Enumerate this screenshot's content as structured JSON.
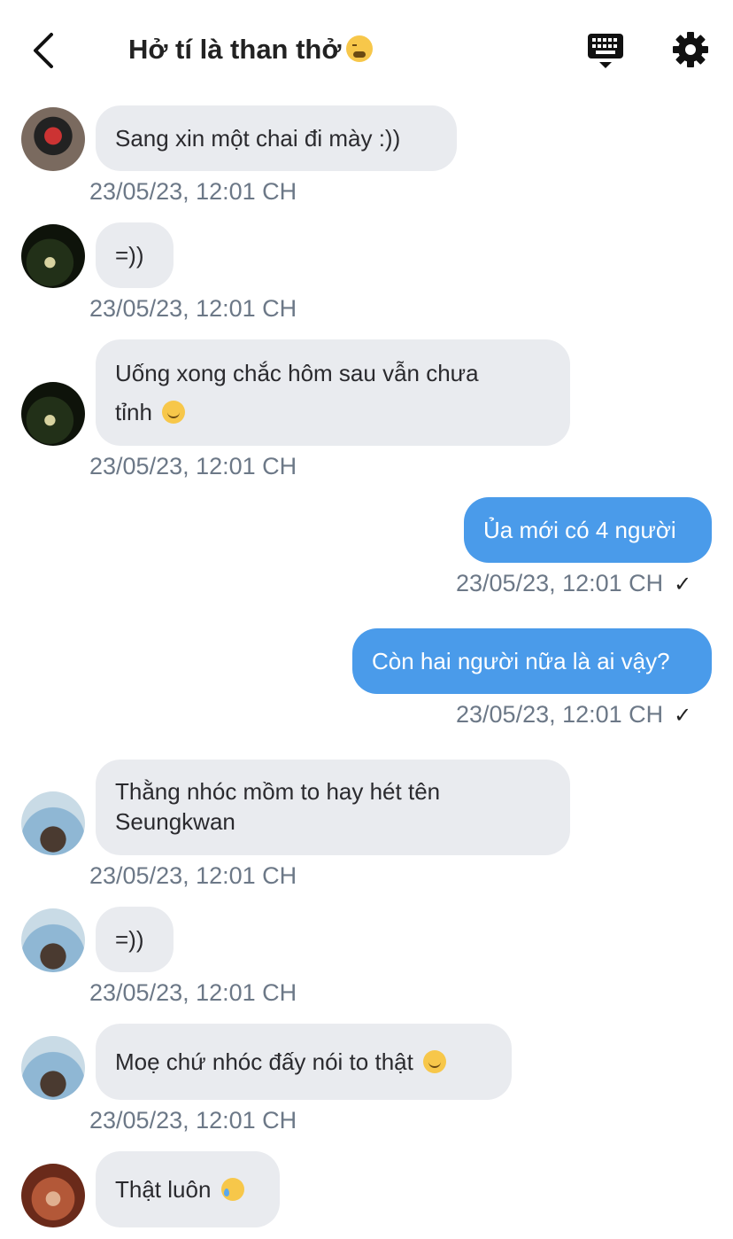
{
  "header": {
    "back_icon": "chevron-left-icon",
    "title": "Hở tí là than thở",
    "title_emoji": "weary-face-emoji",
    "keyboard_icon": "keyboard-icon",
    "settings_icon": "gear-icon"
  },
  "colors": {
    "incoming_bubble": "#e9ebef",
    "outgoing_bubble": "#4a9bea",
    "timestamp": "#6c7887"
  },
  "messages": [
    {
      "direction": "in",
      "avatar": "avatar-user-1",
      "text": "Sang xin một chai đi mày :))",
      "time": "23/05/23, 12:01 CH"
    },
    {
      "direction": "in",
      "avatar": "avatar-user-2",
      "text": "=))",
      "time": "23/05/23, 12:01 CH"
    },
    {
      "direction": "in",
      "avatar": "avatar-user-2",
      "text_line1": "Uống xong chắc hôm sau vẫn chưa",
      "text_line2": "tỉnh",
      "emoji": "slightly-smiling-face-emoji",
      "time": "23/05/23, 12:01 CH"
    },
    {
      "direction": "out",
      "text": "Ủa mới có 4 người",
      "time": "23/05/23, 12:01 CH",
      "check": "✓"
    },
    {
      "direction": "out",
      "text": "Còn hai người nữa là ai vậy?",
      "time": "23/05/23, 12:01 CH",
      "check": "✓"
    },
    {
      "direction": "in",
      "avatar": "avatar-user-3",
      "text_line1": "Thằng nhóc mồm to hay hét tên",
      "text_line2": "Seungkwan",
      "time": "23/05/23, 12:01 CH"
    },
    {
      "direction": "in",
      "avatar": "avatar-user-3",
      "text": "=))",
      "time": "23/05/23, 12:01 CH"
    },
    {
      "direction": "in",
      "avatar": "avatar-user-3",
      "text": "Moẹ chứ nhóc đấy nói to thật",
      "emoji": "slightly-smiling-face-emoji",
      "time": "23/05/23, 12:01 CH"
    },
    {
      "direction": "in",
      "avatar": "avatar-user-4",
      "text": "Thật luôn",
      "emoji": "smiling-face-with-tear-emoji"
    }
  ]
}
